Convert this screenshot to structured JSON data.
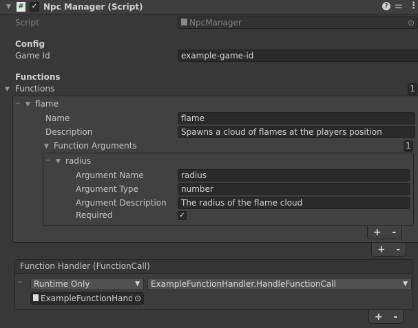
{
  "component": {
    "title": "Npc Manager (Script)",
    "enabled": true
  },
  "script": {
    "label": "Script",
    "value": "NpcManager"
  },
  "config": {
    "header": "Config",
    "game_id_label": "Game Id",
    "game_id_value": "example-game-id"
  },
  "functions": {
    "header": "Functions",
    "foldout_label": "Functions",
    "count": "1",
    "items": [
      {
        "title": "flame",
        "name_label": "Name",
        "name_value": "flame",
        "description_label": "Description",
        "description_value": "Spawns a cloud of flames at the players position",
        "arguments": {
          "label": "Function Arguments",
          "count": "1",
          "items": [
            {
              "title": "radius",
              "name_label": "Argument Name",
              "name_value": "radius",
              "type_label": "Argument Type",
              "type_value": "number",
              "description_label": "Argument Description",
              "description_value": "The radius of the flame cloud",
              "required_label": "Required",
              "required": true
            }
          ]
        }
      }
    ]
  },
  "handler": {
    "title": "Function Handler (FunctionCall)",
    "mode": "Runtime Only",
    "method": "ExampleFunctionHandler.HandleFunctionCall",
    "object": "ExampleFunctionHandl"
  },
  "buttons": {
    "add": "+",
    "remove": "-"
  }
}
